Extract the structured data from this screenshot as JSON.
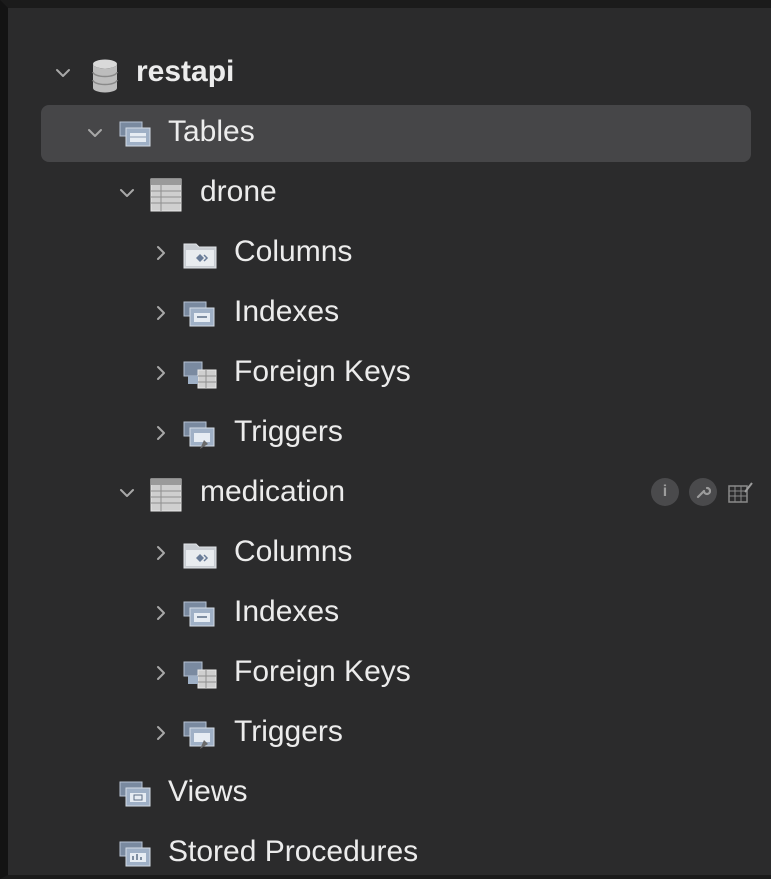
{
  "tree": {
    "database": {
      "label": "restapi",
      "icon": "database-icon",
      "expanded": true
    },
    "tables_group": {
      "label": "Tables",
      "icon": "tables-folder-icon",
      "expanded": true,
      "selected": true
    },
    "tables": [
      {
        "label": "drone",
        "expanded": true,
        "children": [
          {
            "label": "Columns",
            "icon": "columns-folder-icon"
          },
          {
            "label": "Indexes",
            "icon": "indexes-folder-icon"
          },
          {
            "label": "Foreign Keys",
            "icon": "foreign-keys-folder-icon"
          },
          {
            "label": "Triggers",
            "icon": "triggers-folder-icon"
          }
        ]
      },
      {
        "label": "medication",
        "expanded": true,
        "hover_actions": [
          "info-icon",
          "wrench-icon",
          "table-edit-icon"
        ],
        "children": [
          {
            "label": "Columns",
            "icon": "columns-folder-icon"
          },
          {
            "label": "Indexes",
            "icon": "indexes-folder-icon"
          },
          {
            "label": "Foreign Keys",
            "icon": "foreign-keys-folder-icon"
          },
          {
            "label": "Triggers",
            "icon": "triggers-folder-icon"
          }
        ]
      }
    ],
    "views": {
      "label": "Views",
      "icon": "views-folder-icon"
    },
    "stored_procedures": {
      "label": "Stored Procedures",
      "icon": "stored-procedures-folder-icon"
    }
  },
  "colors": {
    "background": "#2b2b2c",
    "selected_row": "#464648",
    "text": "#ececec",
    "chevron": "#a8a8a8"
  }
}
